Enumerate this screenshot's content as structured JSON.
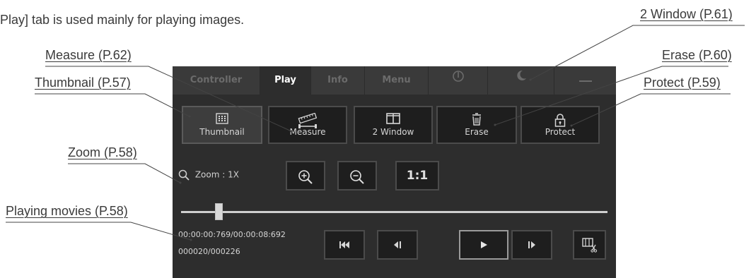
{
  "intro_text": "Play] tab is used mainly for playing images.",
  "callouts": {
    "two_window": "2 Window (P.61)",
    "measure": "Measure (P.62)",
    "erase": "Erase (P.60)",
    "thumbnail": "Thumbnail (P.57)",
    "protect": "Protect (P.59)",
    "zoom": "Zoom (P.58)",
    "playing_movies": "Playing movies (P.58)"
  },
  "tabs": [
    {
      "label": "Controller",
      "active": false
    },
    {
      "label": "Play",
      "active": true
    },
    {
      "label": "Info",
      "active": false
    },
    {
      "label": "Menu",
      "active": false
    },
    {
      "label": "",
      "icon": "power-icon"
    },
    {
      "label": "",
      "icon": "moon-icon"
    },
    {
      "label": "",
      "icon": "minimize-icon"
    }
  ],
  "buttons": {
    "thumbnail": {
      "label": "Thumbnail",
      "icon": "grid-icon",
      "selected": true
    },
    "measure": {
      "label": "Measure",
      "icon": "ruler-icon"
    },
    "two_window": {
      "label": "2 Window",
      "icon": "split-window-icon"
    },
    "erase": {
      "label": "Erase",
      "icon": "trash-icon"
    },
    "protect": {
      "label": "Protect",
      "icon": "lock-icon"
    }
  },
  "zoom": {
    "label": "Zoom : 1X",
    "zoom_in_icon": "zoom-in-icon",
    "zoom_out_icon": "zoom-out-icon",
    "actual_size_label": "1:1"
  },
  "playback": {
    "time_text": "00:00:00:769/00:00:08:692",
    "frame_text": "000020/000226",
    "position_fraction": 0.088,
    "controls": [
      "skip-to-start-icon",
      "step-back-icon",
      "play-icon",
      "step-forward-icon",
      "clip-cut-icon"
    ]
  },
  "colors": {
    "panel_bg": "#2d2d2d",
    "tab_bar_bg": "#3a3a3a",
    "button_bg": "#1e1e1e",
    "button_border": "#4b4b4b",
    "text_light": "#d6d6d6"
  }
}
